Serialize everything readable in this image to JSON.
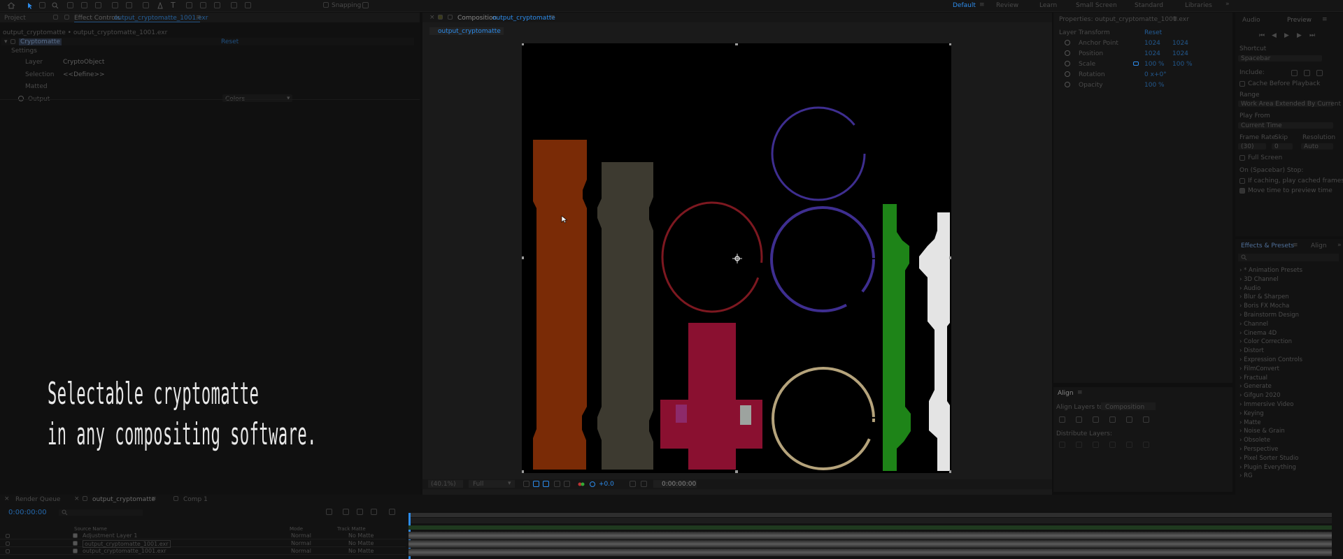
{
  "toolbar": {
    "snapping_label": "Snapping",
    "workspaces": [
      "Default",
      "Review",
      "Learn",
      "Small Screen",
      "Standard",
      "Libraries"
    ]
  },
  "effect_controls": {
    "tab_project": "Project",
    "tab_title": "Effect Controls",
    "tab_layer": "output_cryptomatte_1001.exr",
    "breadcrumb": "output_cryptomatte • output_cryptomatte_1001.exr",
    "effect_name": "Cryptomatte",
    "reset": "Reset",
    "settings": "Settings",
    "layer_label": "Layer",
    "layer_value": "CryptoObject",
    "selection_label": "Selection",
    "selection_value": "<<Define>>",
    "matted_label": "Matted",
    "output_label": "Output",
    "output_value": "Colors"
  },
  "caption": {
    "line1": "Selectable cryptomatte",
    "line2": "in any compositing software."
  },
  "composition": {
    "panel_title": "Composition",
    "comp_name": "output_cryptomatte",
    "tab": "output_cryptomatte",
    "zoom": "(40.1%)",
    "resolution": "Full",
    "exposure": "+0.0",
    "timecode": "0:00:00:00"
  },
  "properties": {
    "title": "Properties: output_cryptomatte_1001.exr",
    "section": "Layer Transform",
    "reset": "Reset",
    "rows": [
      {
        "label": "Anchor Point",
        "v1": "1024",
        "v2": "1024"
      },
      {
        "label": "Position",
        "v1": "1024",
        "v2": "1024"
      },
      {
        "label": "Scale",
        "v1": "100 %",
        "v2": "100 %"
      },
      {
        "label": "Rotation",
        "v1": "0 x+0°",
        "v2": ""
      },
      {
        "label": "Opacity",
        "v1": "100 %",
        "v2": ""
      }
    ]
  },
  "align": {
    "title": "Align",
    "align_to_label": "Align Layers to:",
    "align_to_value": "Composition",
    "distribute": "Distribute Layers:"
  },
  "preview": {
    "tab_audio": "Audio",
    "tab_preview": "Preview",
    "shortcut_label": "Shortcut",
    "shortcut_value": "Spacebar",
    "include_label": "Include:",
    "cache_label": "Cache Before Playback",
    "range_label": "Range",
    "range_value": "Work Area Extended By Current ...",
    "play_from_label": "Play From",
    "play_from_value": "Current Time",
    "frame_rate_label": "Frame Rate",
    "skip_label": "Skip",
    "resolution_label": "Resolution",
    "frame_rate_value": "(30)",
    "skip_value": "0",
    "resolution_value": "Auto",
    "full_screen": "Full Screen",
    "on_stop": "On (Spacebar) Stop:",
    "opt1": "If caching, play cached frames",
    "opt2": "Move time to preview time"
  },
  "effects": {
    "tab": "Effects & Presets",
    "tab_align": "Align",
    "items": [
      "* Animation Presets",
      "3D Channel",
      "Audio",
      "Blur & Sharpen",
      "Boris FX Mocha",
      "Brainstorm Design",
      "Channel",
      "Cinema 4D",
      "Color Correction",
      "Distort",
      "Expression Controls",
      "FilmConvert",
      "Fractual",
      "Generate",
      "Gifgun 2020",
      "Immersive Video",
      "Keying",
      "Matte",
      "Noise & Grain",
      "Obsolete",
      "Perspective",
      "Pixel Sorter Studio",
      "Plugin Everything",
      "RG"
    ]
  },
  "timeline": {
    "tab_render": "Render Queue",
    "tab_comp": "output_cryptomatte",
    "tab_comp2": "Comp 1",
    "timecode": "0:00:00:00",
    "col_source": "Source Name",
    "col_mode": "Mode",
    "col_track": "Track Matte",
    "layers": [
      {
        "name": "Adjustment Layer 1",
        "mode": "Normal",
        "matte": "No Matte"
      },
      {
        "name": "output_cryptomatte_1001.exr",
        "mode": "Normal",
        "matte": "No Matte"
      },
      {
        "name": "output_cryptomatte_1001.exr",
        "mode": "Normal",
        "matte": "No Matte"
      }
    ]
  },
  "colors": {
    "accent": "#2d8ceb",
    "orange_object": "#7a2b06",
    "olive_object": "#3d3a30",
    "crimson_object": "#8a1030",
    "green_object": "#1e8418",
    "white_object": "#e4e4e4",
    "red_ring": "#7d1820",
    "purple_ring": "#3e2e90",
    "tan_ring": "#b5a37b"
  }
}
